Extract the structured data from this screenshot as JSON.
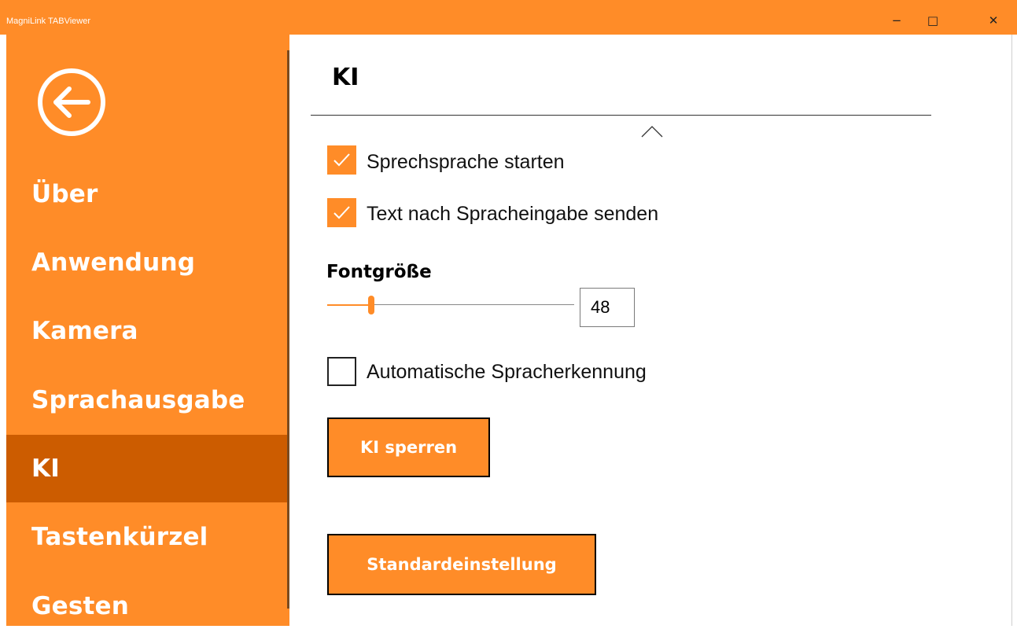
{
  "window": {
    "title": "MagniLink TABViewer",
    "minimize_glyph": "−",
    "maximize_glyph": "□",
    "close_glyph": "✕"
  },
  "colors": {
    "accent": "#ff8c28",
    "active": "#cc5c00"
  },
  "sidebar": {
    "back_icon": "arrow-left-circle-icon",
    "items": [
      {
        "label": "Über",
        "active": false
      },
      {
        "label": "Anwendung",
        "active": false
      },
      {
        "label": "Kamera",
        "active": false
      },
      {
        "label": "Sprachausgabe",
        "active": false
      },
      {
        "label": "KI",
        "active": true
      },
      {
        "label": "Tastenkürzel",
        "active": false
      },
      {
        "label": "Gesten",
        "active": false
      }
    ]
  },
  "main": {
    "title": "KI",
    "options": [
      {
        "label": "Sprechsprache starten",
        "checked": true
      },
      {
        "label": "Text nach Spracheingabe senden",
        "checked": true
      },
      {
        "label": "Automatische Spracherkennung",
        "checked": false
      }
    ],
    "font_size": {
      "label": "Fontgröße",
      "value": "48"
    },
    "lock_button": "KI sperren",
    "default_button": "Standardeinstellung"
  }
}
